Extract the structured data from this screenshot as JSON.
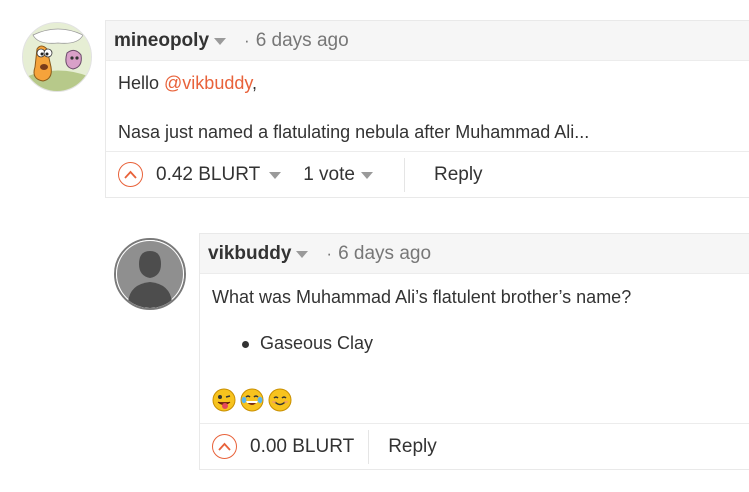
{
  "comments": [
    {
      "username": "mineopoly",
      "time": "6 days ago",
      "greeting_prefix": "Hello ",
      "mention": "@vikbuddy",
      "greeting_suffix": ",",
      "line2": "Nasa just named a flatulating nebula after Muhammad Ali...",
      "payout": "0.42 BLURT",
      "votes": "1 vote",
      "reply_label": "Reply"
    },
    {
      "username": "vikbuddy",
      "time": "6 days ago",
      "line1": "What was Muhammad Ali’s flatulent brother’s name?",
      "bullets": [
        "Gaseous Clay"
      ],
      "emojis": [
        "winking-tongue-emoji",
        "tears-of-joy-emoji",
        "smiling-emoji"
      ],
      "payout": "0.00 BLURT",
      "reply_label": "Reply"
    }
  ],
  "icons": {
    "upvote": "chevron-up-circle-icon",
    "dropdown": "caret-down-icon",
    "default_avatar": "person-silhouette-icon"
  },
  "colors": {
    "accent": "#e8623a",
    "header_bg": "#f6f6f6",
    "border": "#e9e9e9"
  }
}
